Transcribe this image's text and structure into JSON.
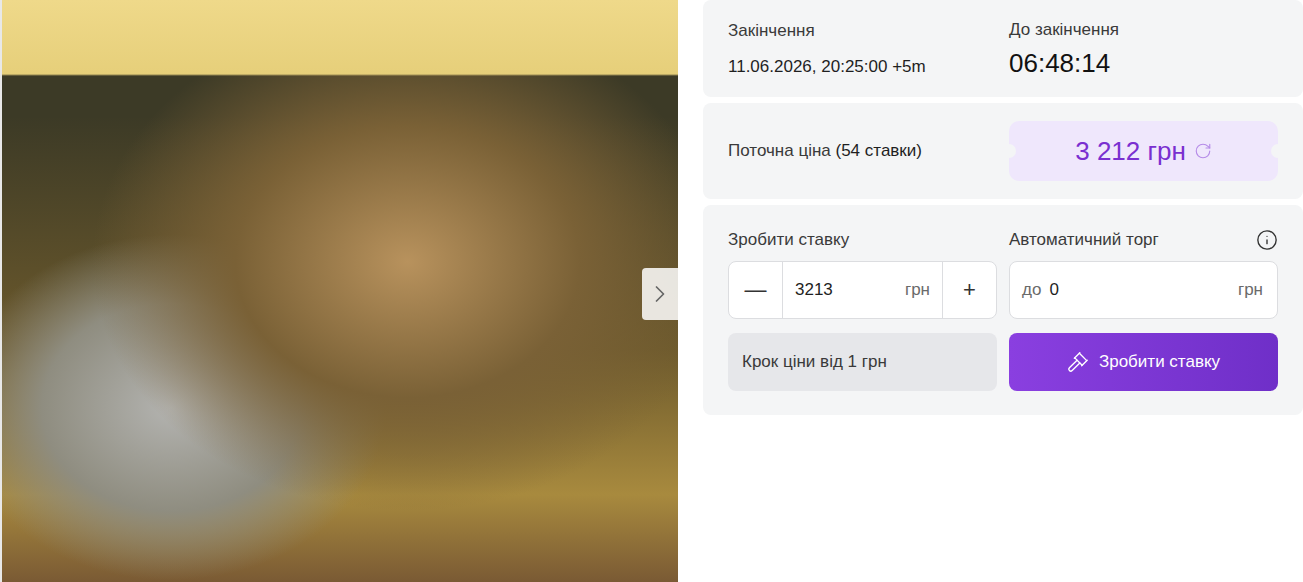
{
  "auction": {
    "end": {
      "label": "Закінчення",
      "value": "11.06.2026, 20:25:00 +5m"
    },
    "countdown": {
      "label": "До закінчення",
      "value": "06:48:14"
    }
  },
  "price": {
    "label": "Поточна ціна",
    "bids": "(54 ставки)",
    "value": "3 212 грн"
  },
  "bid": {
    "label": "Зробити ставку",
    "value": "3213",
    "currency": "грн",
    "minus": "—",
    "plus": "+"
  },
  "auto_bid": {
    "label": "Автоматичний торг",
    "prefix": "до",
    "value": "0",
    "currency": "грн"
  },
  "step": "Крок ціни від 1 грн",
  "submit": "Зробити ставку"
}
